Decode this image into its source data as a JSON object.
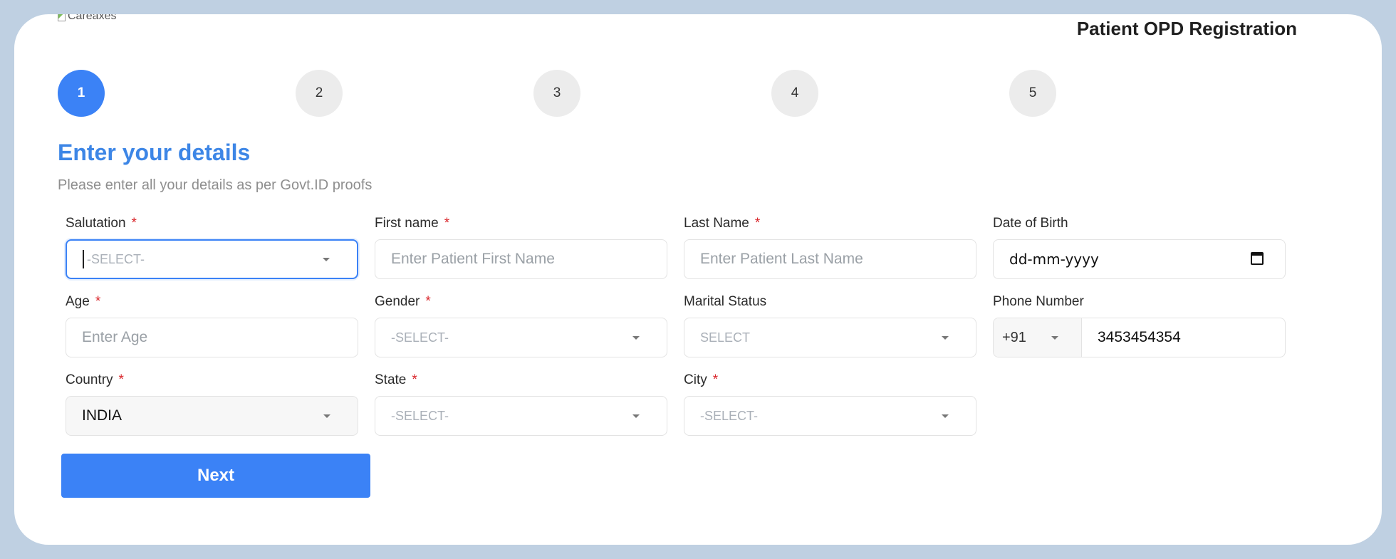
{
  "header": {
    "logo_alt": "Careaxes",
    "page_title": "Patient OPD Registration"
  },
  "steps": [
    "1",
    "2",
    "3",
    "4",
    "5"
  ],
  "form": {
    "heading": "Enter your details",
    "subheading": "Please enter all your details as per Govt.ID proofs",
    "required_mark": "*",
    "fields": {
      "salutation": {
        "label": "Salutation",
        "placeholder": "-SELECT-"
      },
      "first_name": {
        "label": "First name",
        "placeholder": "Enter Patient First Name"
      },
      "last_name": {
        "label": "Last Name",
        "placeholder": "Enter Patient Last Name"
      },
      "dob": {
        "label": "Date of Birth",
        "placeholder": "dd-mm-yyyy"
      },
      "age": {
        "label": "Age",
        "placeholder": "Enter Age"
      },
      "gender": {
        "label": "Gender",
        "placeholder": "-SELECT-"
      },
      "marital_status": {
        "label": "Marital Status",
        "placeholder": "SELECT"
      },
      "phone": {
        "label": "Phone Number",
        "country_code": "+91",
        "value": "3453454354"
      },
      "country": {
        "label": "Country",
        "value": "INDIA"
      },
      "state": {
        "label": "State",
        "placeholder": "-SELECT-"
      },
      "city": {
        "label": "City",
        "placeholder": "-SELECT-"
      }
    },
    "next_label": "Next"
  },
  "colors": {
    "accent": "#3b82f6",
    "heading": "#3d86e6",
    "required": "#d9252a",
    "frame": "#bfd0e2"
  }
}
